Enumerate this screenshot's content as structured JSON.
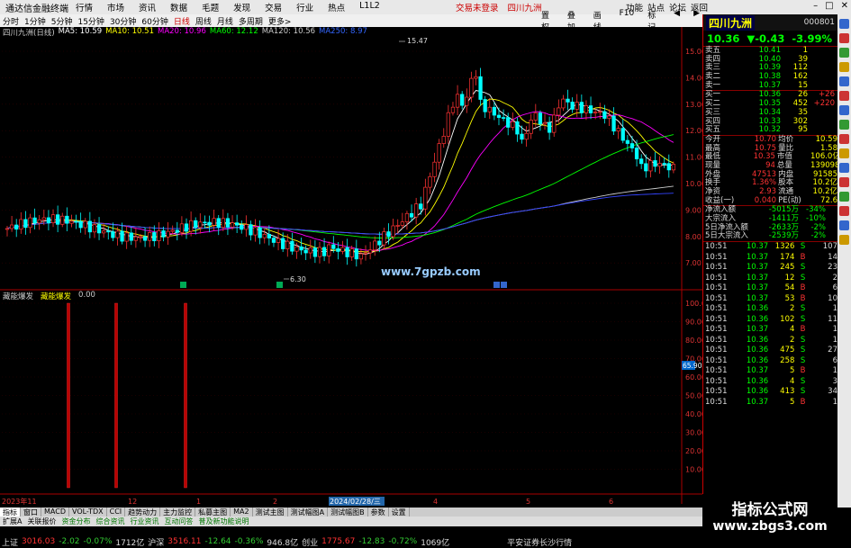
{
  "app": {
    "title": "通达信金融终端",
    "menus": [
      "行情",
      "市场",
      "资讯",
      "数据",
      "毛题",
      "发现",
      "交易",
      "行业",
      "热点",
      "L1L2"
    ],
    "center": [
      "交易未登录",
      "四川九洲"
    ],
    "right": [
      "功能",
      "站点",
      "论坛",
      "返回"
    ]
  },
  "periods": [
    "分时",
    "1分钟",
    "5分钟",
    "15分钟",
    "30分钟",
    "60分钟",
    "日线",
    "周线",
    "月线",
    "多周期",
    "更多>"
  ],
  "period_active": 6,
  "period_right": [
    "置权",
    "叠加",
    "画线",
    "F10",
    "标记",
    "◀",
    "▶"
  ],
  "info": {
    "stock": "四川九洲(日线)",
    "ma5": "MA5: 10.59",
    "ma10": "MA10: 10.51",
    "ma20": "MA20: 10.96",
    "ma60": "MA60: 12.12",
    "ma120": "MA120: 10.56",
    "ma250": "MA250: 8.97"
  },
  "price_axis": [
    "15.00",
    "14.00",
    "13.00",
    "12.00",
    "11.00",
    "10.00",
    "9.00",
    "8.00",
    "7.00"
  ],
  "ind_axis": [
    "100.00",
    "90.00",
    "80.00",
    "70.00",
    "60.00",
    "50.00",
    "40.00",
    "30.00",
    "20.00",
    "10.00"
  ],
  "annot": {
    "high": "15.47",
    "low": "6.30",
    "marker": "65.90",
    "watermark": "www.7gpzb.com"
  },
  "indicator": {
    "name": "藏能爆发",
    "label": "藏能爆发",
    "value": "0.00"
  },
  "dates": [
    "2023年11",
    "12",
    "1",
    "2",
    "2024/02/28/三",
    "4",
    "5",
    "6"
  ],
  "colors": {
    "up": "#ff3333",
    "down": "#00ffff",
    "ma5": "#ffffff",
    "ma10": "#ffff00",
    "ma20": "#ff00ff",
    "ma60": "#00ff00",
    "ma120": "#cccccc",
    "ma250": "#3344ff"
  },
  "quote": {
    "name": "四川九洲",
    "code": "000801",
    "price": "10.36",
    "change": "▼-0.43",
    "pct": "-3.99%",
    "sells": [
      [
        "卖五",
        "10.41",
        "1"
      ],
      [
        "卖四",
        "10.40",
        "39"
      ],
      [
        "卖三",
        "10.39",
        "112"
      ],
      [
        "卖二",
        "10.38",
        "162"
      ],
      [
        "卖一",
        "10.37",
        "15"
      ]
    ],
    "buys": [
      [
        "买一",
        "10.36",
        "26",
        "+26"
      ],
      [
        "买二",
        "10.35",
        "452",
        "+220"
      ],
      [
        "买三",
        "10.34",
        "35",
        ""
      ],
      [
        "买四",
        "10.33",
        "302",
        ""
      ],
      [
        "买五",
        "10.32",
        "95",
        ""
      ]
    ],
    "stats": [
      [
        "今开",
        "10.70",
        "均价",
        "10.59"
      ],
      [
        "最高",
        "10.75",
        "量比",
        "1.58"
      ],
      [
        "最低",
        "10.35",
        "市值",
        "106.0亿"
      ],
      [
        "现量",
        "94",
        "总量",
        "139098"
      ],
      [
        "外盘",
        "47513",
        "内盘",
        "91585"
      ],
      [
        "换手",
        "1.36%",
        "股本",
        "10.2亿"
      ],
      [
        "净资",
        "2.93",
        "流通",
        "10.2亿"
      ],
      [
        "收益(一)",
        "0.040",
        "PE(动)",
        "72.6"
      ]
    ],
    "flows": [
      [
        "净流入额",
        "-5015万",
        "-34%"
      ],
      [
        "大宗流入",
        "-1411万",
        "-10%"
      ],
      [
        "5日净流入额",
        "-2633万",
        "-2%"
      ],
      [
        "5日大宗流入",
        "-2539万",
        "-2%"
      ]
    ],
    "ticks": [
      [
        "10:51",
        "10.37",
        "1326",
        "S",
        "107"
      ],
      [
        "10:51",
        "10.37",
        "174",
        "B",
        "14"
      ],
      [
        "10:51",
        "10.37",
        "245",
        "S",
        "23"
      ],
      [
        "10:51",
        "10.37",
        "12",
        "S",
        "2"
      ],
      [
        "10:51",
        "10.37",
        "54",
        "B",
        "6"
      ],
      [
        "10:51",
        "10.37",
        "53",
        "B",
        "10"
      ],
      [
        "10:51",
        "10.36",
        "2",
        "S",
        "1"
      ],
      [
        "10:51",
        "10.36",
        "102",
        "S",
        "11"
      ],
      [
        "10:51",
        "10.37",
        "4",
        "B",
        "1"
      ],
      [
        "10:51",
        "10.36",
        "2",
        "S",
        "1"
      ],
      [
        "10:51",
        "10.36",
        "475",
        "S",
        "27"
      ],
      [
        "10:51",
        "10.36",
        "258",
        "S",
        "6"
      ],
      [
        "10:51",
        "10.37",
        "5",
        "B",
        "1"
      ],
      [
        "10:51",
        "10.36",
        "4",
        "S",
        "3"
      ],
      [
        "10:51",
        "10.36",
        "413",
        "S",
        "34"
      ],
      [
        "10:51",
        "10.37",
        "5",
        "B",
        "1"
      ]
    ]
  },
  "bottom_tabs": [
    "指标",
    "窗口",
    "MACD",
    "VOL-TDX",
    "CCI",
    "趋势动力",
    "主力监控",
    "私募主图",
    "MA2",
    "测试主图",
    "测试幅图A",
    "测试幅图B",
    "参数",
    "设置"
  ],
  "bottom_tabs2": [
    "扩展A",
    "关联报价",
    "资金分布",
    "综合资讯",
    "行业资讯",
    "互动问答",
    "普及新功能说明"
  ],
  "status": {
    "sh_label": "上证",
    "sh_val": "3016.03",
    "sh_chg": "-2.02",
    "sh_pct": "-0.07%",
    "sh_amt": "1712亿",
    "sz_label": "沪深",
    "sz_val": "3516.11",
    "sz_chg": "-12.64",
    "sz_pct": "-0.36%",
    "sz_amt": "946.8亿",
    "cy_label": "创业",
    "cy_val": "1775.67",
    "cy_chg": "-12.83",
    "cy_pct": "-0.72%",
    "cy_amt": "1069亿",
    "broker": "平安证券长沙行情"
  },
  "watermark2": {
    "a": "指标公式网",
    "b": "www.zbgs3.com"
  }
}
